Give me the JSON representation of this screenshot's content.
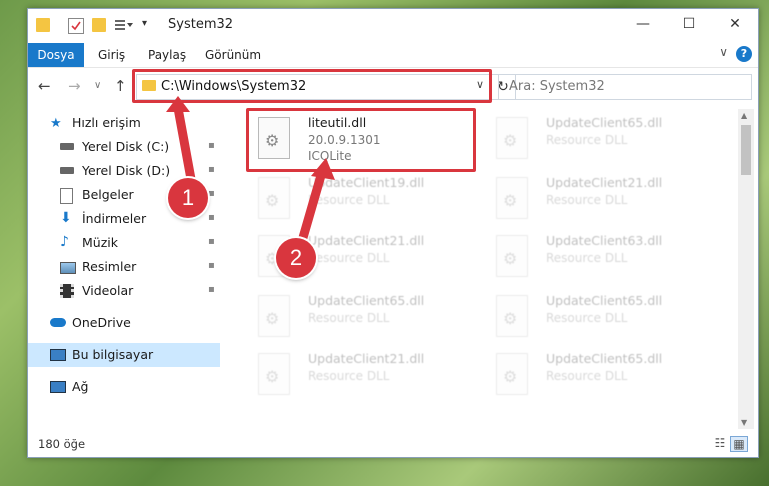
{
  "window": {
    "title": "System32",
    "controls": {
      "minimize": "—",
      "maximize": "☐",
      "close": "✕"
    }
  },
  "ribbon": {
    "tabs": [
      "Dosya",
      "Giriş",
      "Paylaş",
      "Görünüm"
    ],
    "collapse_glyph": "∨",
    "help_glyph": "?"
  },
  "nav": {
    "back": "←",
    "forward": "→",
    "recent": "∨",
    "up": "↑",
    "address": "C:\\Windows\\System32",
    "address_dropdown": "∨",
    "refresh": "↻",
    "search_placeholder": "Ara: System32"
  },
  "sidebar": {
    "items": [
      {
        "label": "Hızlı erişim",
        "icon": "star-icon"
      },
      {
        "label": "Yerel Disk (C:)",
        "icon": "drive-icon",
        "pinned": true
      },
      {
        "label": "Yerel Disk (D:)",
        "icon": "drive-icon",
        "pinned": true
      },
      {
        "label": "Belgeler",
        "icon": "documents-icon",
        "pinned": true
      },
      {
        "label": "İndirmeler",
        "icon": "download-icon",
        "pinned": true
      },
      {
        "label": "Müzik",
        "icon": "music-icon",
        "pinned": true
      },
      {
        "label": "Resimler",
        "icon": "pictures-icon",
        "pinned": true
      },
      {
        "label": "Videolar",
        "icon": "video-icon",
        "pinned": true
      },
      {
        "label": "OneDrive",
        "icon": "cloud-icon"
      },
      {
        "label": "Bu bilgisayar",
        "icon": "computer-icon",
        "selected": true
      },
      {
        "label": "Ağ",
        "icon": "network-icon"
      }
    ],
    "pin_glyph": "📌"
  },
  "files": {
    "highlighted": {
      "name": "liteutil.dll",
      "version": "20.0.9.1301",
      "company": "ICQLite"
    },
    "items": [
      {
        "name": "UpdateClient65.dll",
        "desc": "Resource DLL"
      },
      {
        "name": "UpdateClient19.dll",
        "desc": "Resource DLL"
      },
      {
        "name": "UpdateClient21.dll",
        "desc": "Resource DLL"
      },
      {
        "name": "UpdateClient21.dll",
        "desc": "Resource DLL"
      },
      {
        "name": "UpdateClient63.dll",
        "desc": "Resource DLL"
      },
      {
        "name": "UpdateClient65.dll",
        "desc": "Resource DLL"
      },
      {
        "name": "UpdateClient65.dll",
        "desc": "Resource DLL"
      },
      {
        "name": "UpdateClient21.dll",
        "desc": "Resource DLL"
      },
      {
        "name": "UpdateClient65.dll",
        "desc": "Resource DLL"
      }
    ]
  },
  "status": {
    "item_count": "180 öğe"
  },
  "annotations": {
    "badge1": "1",
    "badge2": "2",
    "color": "#d9363e"
  }
}
